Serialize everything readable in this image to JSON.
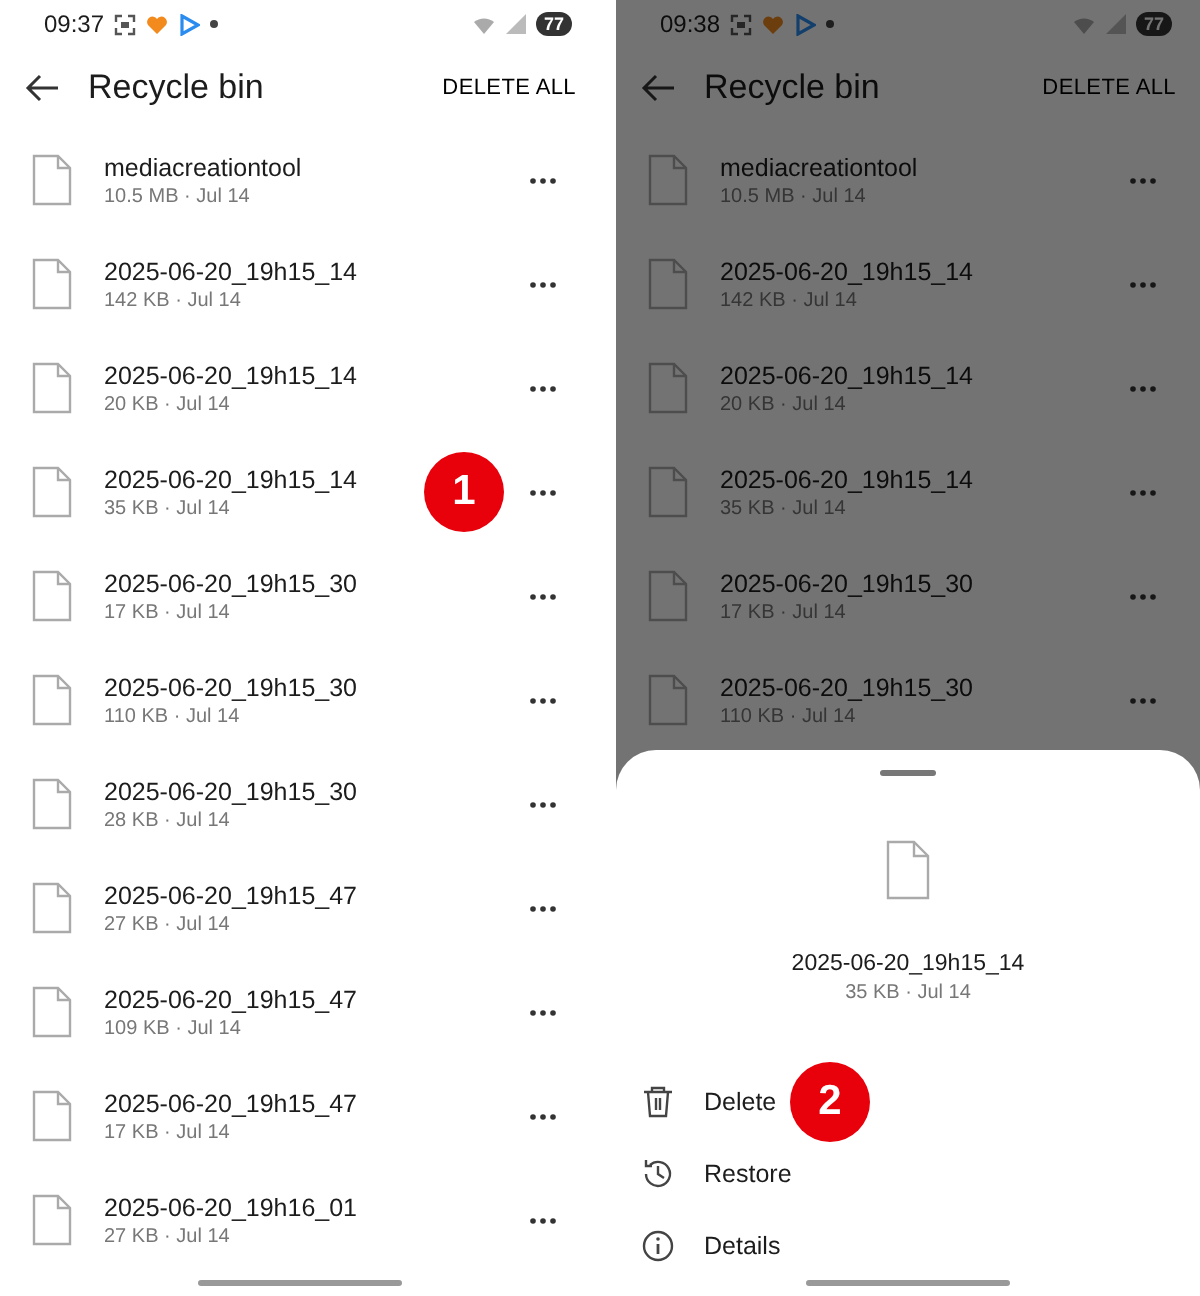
{
  "screens": [
    {
      "status_bar": {
        "time": "09:37",
        "battery": "77"
      },
      "title": "Recycle bin",
      "action": "DELETE ALL",
      "dimmed": false,
      "files": [
        {
          "name": "mediacreationtool",
          "meta": "10.5 MB · Jul 14"
        },
        {
          "name": "2025-06-20_19h15_14",
          "meta": "142 KB · Jul 14"
        },
        {
          "name": "2025-06-20_19h15_14",
          "meta": "20 KB · Jul 14"
        },
        {
          "name": "2025-06-20_19h15_14",
          "meta": "35 KB · Jul 14",
          "step": "1"
        },
        {
          "name": "2025-06-20_19h15_30",
          "meta": "17 KB · Jul 14"
        },
        {
          "name": "2025-06-20_19h15_30",
          "meta": "110 KB · Jul 14"
        },
        {
          "name": "2025-06-20_19h15_30",
          "meta": "28 KB · Jul 14"
        },
        {
          "name": "2025-06-20_19h15_47",
          "meta": "27 KB · Jul 14"
        },
        {
          "name": "2025-06-20_19h15_47",
          "meta": "109 KB · Jul 14"
        },
        {
          "name": "2025-06-20_19h15_47",
          "meta": "17 KB · Jul 14"
        },
        {
          "name": "2025-06-20_19h16_01",
          "meta": "27 KB · Jul 14"
        }
      ]
    },
    {
      "status_bar": {
        "time": "09:38",
        "battery": "77"
      },
      "title": "Recycle bin",
      "action": "DELETE ALL",
      "dimmed": true,
      "files": [
        {
          "name": "mediacreationtool",
          "meta": "10.5 MB · Jul 14"
        },
        {
          "name": "2025-06-20_19h15_14",
          "meta": "142 KB · Jul 14"
        },
        {
          "name": "2025-06-20_19h15_14",
          "meta": "20 KB · Jul 14"
        },
        {
          "name": "2025-06-20_19h15_14",
          "meta": "35 KB · Jul 14"
        },
        {
          "name": "2025-06-20_19h15_30",
          "meta": "17 KB · Jul 14"
        },
        {
          "name": "2025-06-20_19h15_30",
          "meta": "110 KB · Jul 14"
        }
      ],
      "sheet": {
        "name": "2025-06-20_19h15_14",
        "meta": "35 KB · Jul 14",
        "actions": [
          {
            "kind": "delete",
            "label": "Delete",
            "step": "2"
          },
          {
            "kind": "restore",
            "label": "Restore"
          },
          {
            "kind": "details",
            "label": "Details"
          }
        ]
      }
    }
  ]
}
